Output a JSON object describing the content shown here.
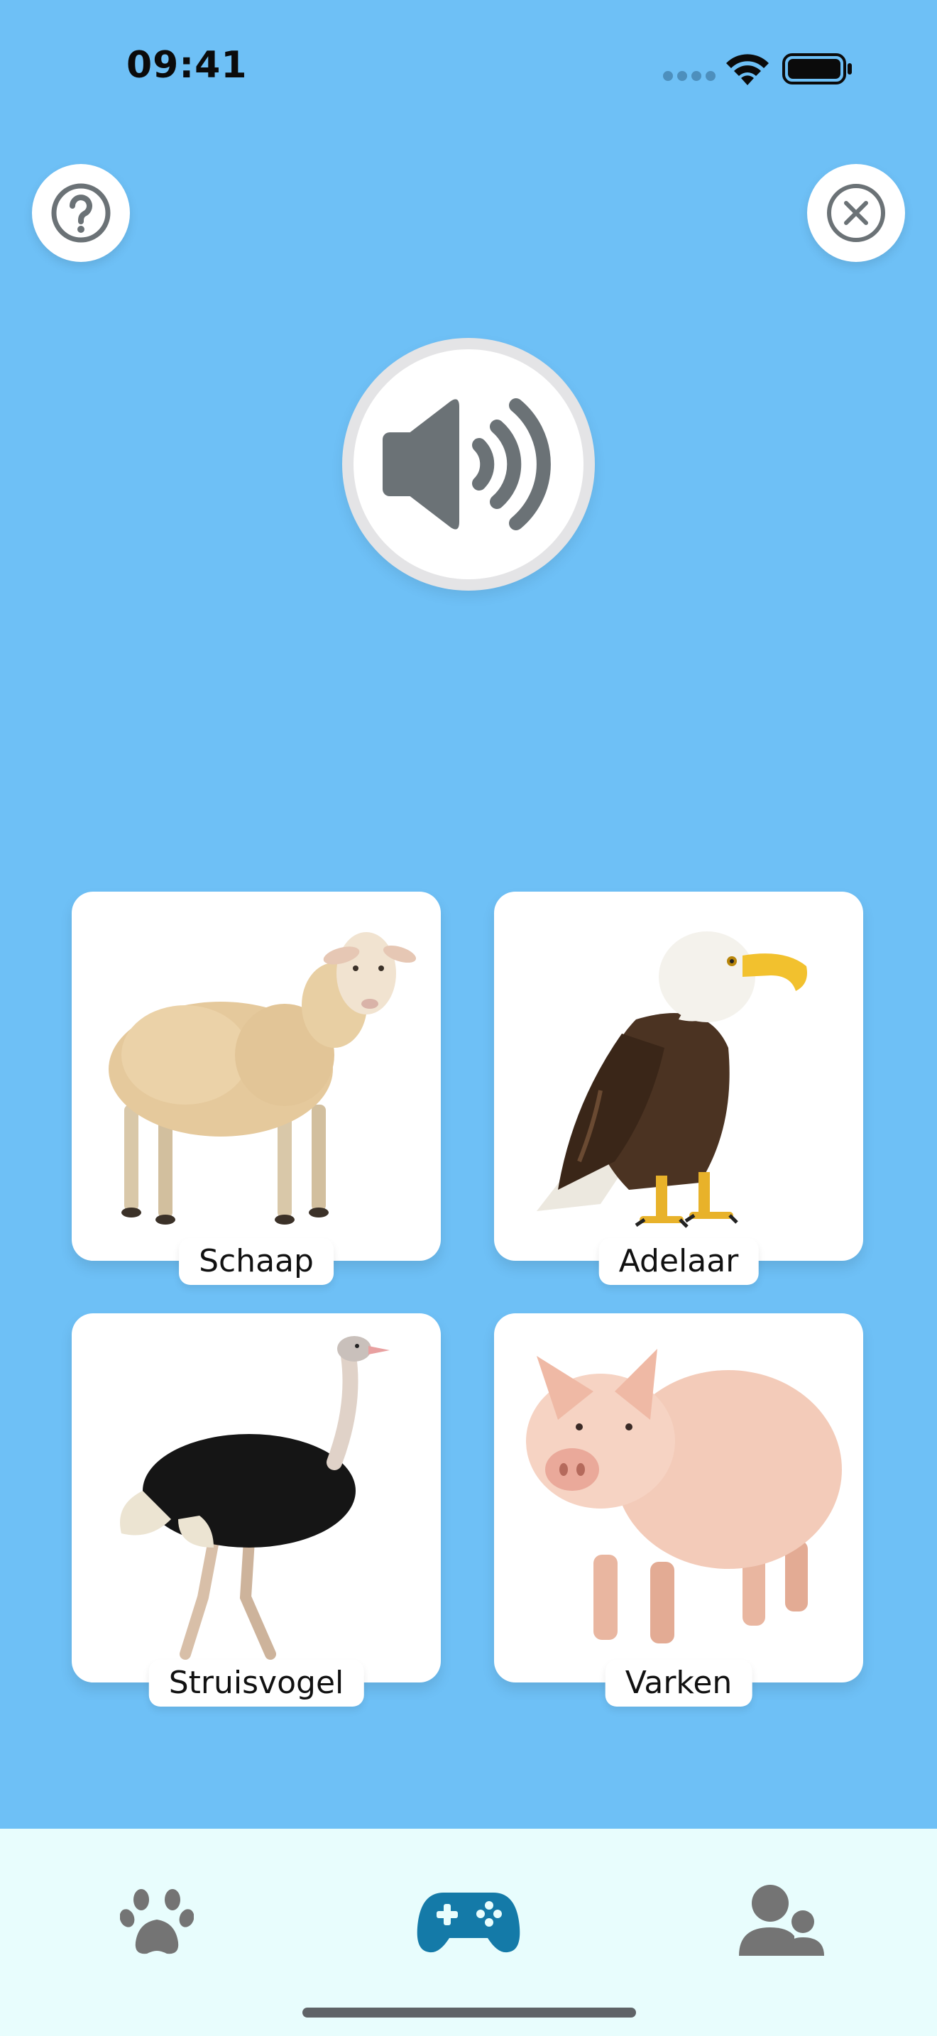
{
  "status_bar": {
    "time": "09:41"
  },
  "toolbar": {
    "help_icon": "question-circle-icon",
    "close_icon": "close-circle-icon"
  },
  "sound_button": {
    "icon": "speaker-volume-icon"
  },
  "choices": [
    {
      "label": "Schaap",
      "image": "sheep"
    },
    {
      "label": "Adelaar",
      "image": "eagle"
    },
    {
      "label": "Struisvogel",
      "image": "ostrich"
    },
    {
      "label": "Varken",
      "image": "pig"
    }
  ],
  "tab_bar": {
    "items": [
      {
        "icon": "paw-icon",
        "active": false
      },
      {
        "icon": "gamepad-icon",
        "active": true
      },
      {
        "icon": "users-icon",
        "active": false
      }
    ],
    "active_color": "#147aa8",
    "inactive_color": "#747474"
  },
  "colors": {
    "background": "#6ec0f6",
    "icon_gray": "#6b7276",
    "tab_bar_bg": "#e8fdfd"
  }
}
